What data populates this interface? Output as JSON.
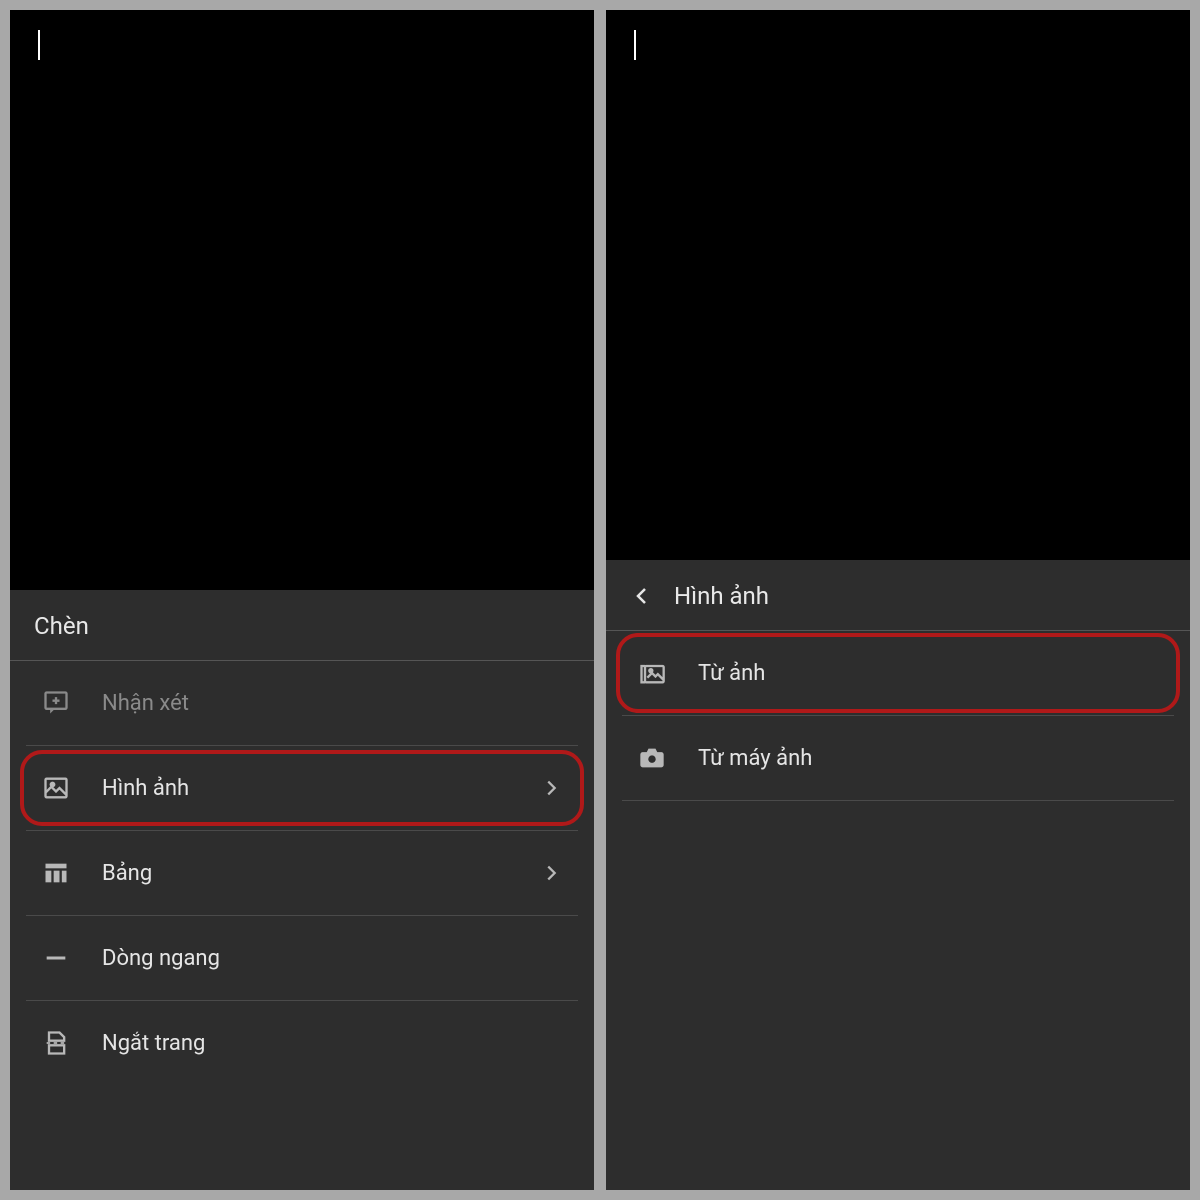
{
  "left": {
    "sheet_title": "Chèn",
    "items": [
      {
        "label": "Nhận xét"
      },
      {
        "label": "Hình ảnh"
      },
      {
        "label": "Bảng"
      },
      {
        "label": "Dòng ngang"
      },
      {
        "label": "Ngắt trang"
      }
    ]
  },
  "right": {
    "sheet_title": "Hình ảnh",
    "items": [
      {
        "label": "Từ ảnh"
      },
      {
        "label": "Từ máy ảnh"
      }
    ]
  }
}
